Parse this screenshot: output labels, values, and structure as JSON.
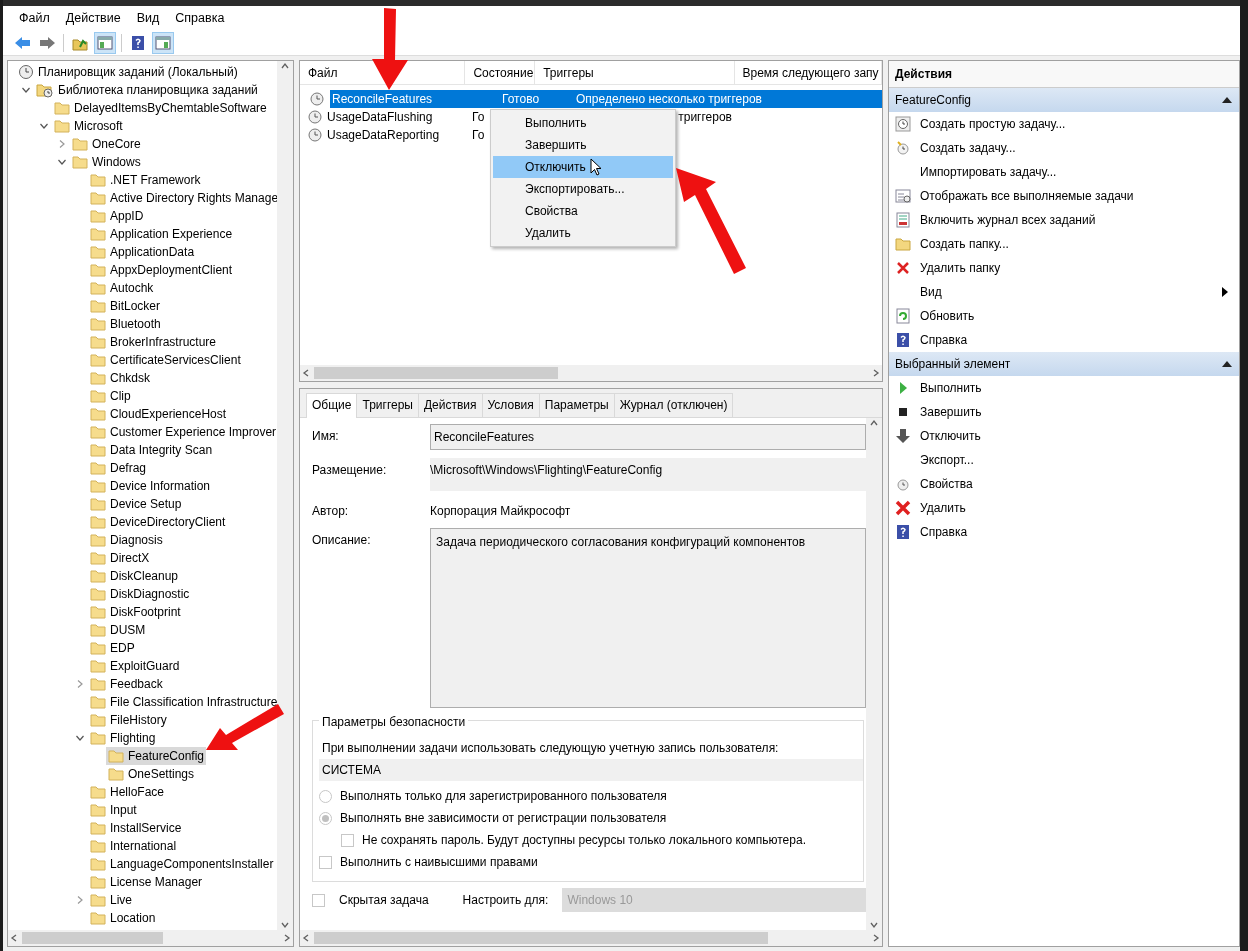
{
  "menu": [
    {
      "label": "Файл"
    },
    {
      "label": "Действие"
    },
    {
      "label": "Вид"
    },
    {
      "label": "Справка"
    }
  ],
  "toolbar": [
    {
      "kind": "back"
    },
    {
      "kind": "forward"
    },
    {
      "kind": "folder-up"
    },
    {
      "kind": "tree-toggle",
      "on": true
    },
    {
      "kind": "help"
    },
    {
      "kind": "pane-toggle",
      "on": true
    }
  ],
  "tree": {
    "label": "Планировщик заданий (Локальный)",
    "selected": false,
    "children": [
      {
        "label": "Библиотека планировщика заданий",
        "expanded": true,
        "selected": false,
        "children": [
          {
            "label": "DelayedItemsByChemtableSoftware",
            "selected": false
          },
          {
            "label": "Microsoft",
            "expanded": true,
            "selected": false,
            "children": [
              {
                "label": "OneCore",
                "expanded": false,
                "selected": false
              },
              {
                "label": "Windows",
                "expanded": true,
                "selected": false,
                "children": [
                  {
                    "label": ".NET Framework",
                    "selected": false
                  },
                  {
                    "label": "Active Directory Rights Manage",
                    "selected": false
                  },
                  {
                    "label": "AppID",
                    "selected": false
                  },
                  {
                    "label": "Application Experience",
                    "selected": false
                  },
                  {
                    "label": "ApplicationData",
                    "selected": false
                  },
                  {
                    "label": "AppxDeploymentClient",
                    "selected": false
                  },
                  {
                    "label": "Autochk",
                    "selected": false
                  },
                  {
                    "label": "BitLocker",
                    "selected": false
                  },
                  {
                    "label": "Bluetooth",
                    "selected": false
                  },
                  {
                    "label": "BrokerInfrastructure",
                    "selected": false
                  },
                  {
                    "label": "CertificateServicesClient",
                    "selected": false
                  },
                  {
                    "label": "Chkdsk",
                    "selected": false
                  },
                  {
                    "label": "Clip",
                    "selected": false
                  },
                  {
                    "label": "CloudExperienceHost",
                    "selected": false
                  },
                  {
                    "label": "Customer Experience Improver",
                    "selected": false
                  },
                  {
                    "label": "Data Integrity Scan",
                    "selected": false
                  },
                  {
                    "label": "Defrag",
                    "selected": false
                  },
                  {
                    "label": "Device Information",
                    "selected": false
                  },
                  {
                    "label": "Device Setup",
                    "selected": false
                  },
                  {
                    "label": "DeviceDirectoryClient",
                    "selected": false
                  },
                  {
                    "label": "Diagnosis",
                    "selected": false
                  },
                  {
                    "label": "DirectX",
                    "selected": false
                  },
                  {
                    "label": "DiskCleanup",
                    "selected": false
                  },
                  {
                    "label": "DiskDiagnostic",
                    "selected": false
                  },
                  {
                    "label": "DiskFootprint",
                    "selected": false
                  },
                  {
                    "label": "DUSM",
                    "selected": false
                  },
                  {
                    "label": "EDP",
                    "selected": false
                  },
                  {
                    "label": "ExploitGuard",
                    "selected": false
                  },
                  {
                    "label": "Feedback",
                    "expanded": false,
                    "selected": false
                  },
                  {
                    "label": "File Classification Infrastructure",
                    "selected": false
                  },
                  {
                    "label": "FileHistory",
                    "selected": false
                  },
                  {
                    "label": "Flighting",
                    "expanded": true,
                    "selected": false,
                    "children": [
                      {
                        "label": "FeatureConfig",
                        "selected": true
                      },
                      {
                        "label": "OneSettings",
                        "selected": false
                      }
                    ]
                  },
                  {
                    "label": "HelloFace",
                    "selected": false
                  },
                  {
                    "label": "Input",
                    "selected": false
                  },
                  {
                    "label": "InstallService",
                    "selected": false
                  },
                  {
                    "label": "International",
                    "selected": false
                  },
                  {
                    "label": "LanguageComponentsInstaller",
                    "selected": false
                  },
                  {
                    "label": "License Manager",
                    "selected": false
                  },
                  {
                    "label": "Live",
                    "expanded": false,
                    "selected": false
                  },
                  {
                    "label": "Location",
                    "selected": false
                  }
                ]
              }
            ]
          }
        ]
      }
    ]
  },
  "task_list": {
    "columns": [
      "Файл",
      "Состояние",
      "Триггеры",
      "Время следующего запу"
    ],
    "rows": [
      {
        "name": "ReconcileFeatures",
        "status": "Готово",
        "triggers": "Определено несколько триггеров",
        "selected": true
      },
      {
        "name": "UsageDataFlushing",
        "status": "Го",
        "triggers": "триггеров",
        "selected": false
      },
      {
        "name": "UsageDataReporting",
        "status": "Го",
        "selected": false
      }
    ]
  },
  "context_menu": [
    {
      "label": "Выполнить",
      "selected": false
    },
    {
      "label": "Завершить",
      "selected": false
    },
    {
      "label": "Отключить",
      "selected": true
    },
    {
      "label": "Экспортировать...",
      "selected": false
    },
    {
      "label": "Свойства",
      "selected": false
    },
    {
      "label": "Удалить",
      "selected": false
    }
  ],
  "details": {
    "tabs": [
      {
        "label": "Общие",
        "selected": true
      },
      {
        "label": "Триггеры",
        "selected": false
      },
      {
        "label": "Действия",
        "selected": false
      },
      {
        "label": "Условия",
        "selected": false
      },
      {
        "label": "Параметры",
        "selected": false
      },
      {
        "label": "Журнал (отключен)",
        "selected": false
      }
    ],
    "fields": [
      {
        "kind": "input",
        "label": "Имя:",
        "value": "ReconcileFeatures"
      },
      {
        "kind": "readonly",
        "label": "Размещение:",
        "value": "\\Microsoft\\Windows\\Flighting\\FeatureConfig"
      },
      {
        "kind": "text",
        "label": "Автор:",
        "value": "Корпорация Майкрософт"
      },
      {
        "kind": "textarea",
        "label": "Описание:",
        "value": "Задача периодического согласования конфигураций компонентов"
      }
    ],
    "security": {
      "title": "Параметры безопасности",
      "account_prompt": "При выполнении задачи использовать следующую учетную запись пользователя:",
      "account": "СИСТЕМА",
      "options": [
        {
          "kind": "radio",
          "label": "Выполнять только для зарегистрированного пользователя",
          "selected": false
        },
        {
          "kind": "radio",
          "label": "Выполнять вне зависимости от регистрации пользователя",
          "selected": true,
          "children": [
            {
              "kind": "checkbox",
              "label": "Не сохранять пароль. Будут доступны ресурсы только локального компьютера.",
              "checked": false
            }
          ]
        },
        {
          "kind": "checkbox",
          "label": "Выполнить с наивысшими правами",
          "checked": false
        }
      ]
    },
    "hidden": {
      "label": "Скрытая задача",
      "checked": false
    },
    "configure": {
      "label": "Настроить для:",
      "value": "Windows 10"
    }
  },
  "actions": {
    "title": "Действия",
    "sections": [
      {
        "title": "FeatureConfig",
        "expanded": true,
        "items": [
          {
            "label": "Создать простую задачу...",
            "kind": "simple-task"
          },
          {
            "label": "Создать задачу...",
            "kind": "task"
          },
          {
            "label": "Импортировать задачу...",
            "kind": "none"
          },
          {
            "label": "Отображать все выполняемые задачи",
            "kind": "list"
          },
          {
            "label": "Включить журнал всех заданий",
            "kind": "log"
          },
          {
            "label": "Создать папку...",
            "kind": "folder"
          },
          {
            "label": "Удалить папку",
            "kind": "delete"
          },
          {
            "label": "Вид",
            "kind": "none",
            "submenu": true
          },
          {
            "label": "Обновить",
            "kind": "refresh"
          },
          {
            "label": "Справка",
            "kind": "help"
          }
        ]
      },
      {
        "title": "Выбранный элемент",
        "expanded": true,
        "items": [
          {
            "label": "Выполнить",
            "kind": "run"
          },
          {
            "label": "Завершить",
            "kind": "stop"
          },
          {
            "label": "Отключить",
            "kind": "disable"
          },
          {
            "label": "Экспорт...",
            "kind": "none"
          },
          {
            "label": "Свойства",
            "kind": "properties"
          },
          {
            "label": "Удалить",
            "kind": "delete-big"
          },
          {
            "label": "Справка",
            "kind": "help"
          }
        ]
      }
    ]
  }
}
